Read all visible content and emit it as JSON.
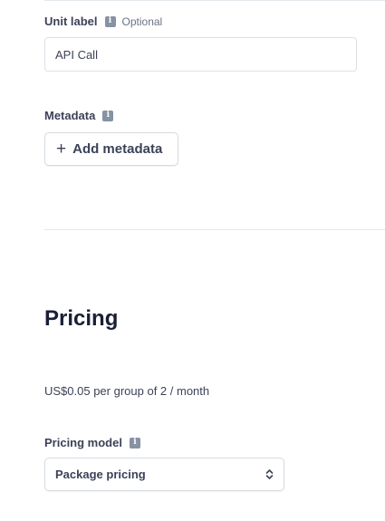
{
  "unit_label": {
    "label": "Unit label",
    "info_icon": "info-icon",
    "optional": "Optional",
    "value": "API Call"
  },
  "metadata": {
    "label": "Metadata",
    "info_icon": "info-icon",
    "add_button": "Add metadata",
    "add_icon": "plus-icon"
  },
  "pricing": {
    "title": "Pricing",
    "summary": "US$0.05 per group of 2 / month",
    "model_label": "Pricing model",
    "info_icon": "info-icon",
    "model_value": "Package pricing",
    "select_icon": "chevron-up-down-icon"
  },
  "colors": {
    "text": "#3c4257",
    "heading": "#1a1f36",
    "muted": "#697386",
    "border": "#dce1e7",
    "icon": "#8792a2"
  }
}
